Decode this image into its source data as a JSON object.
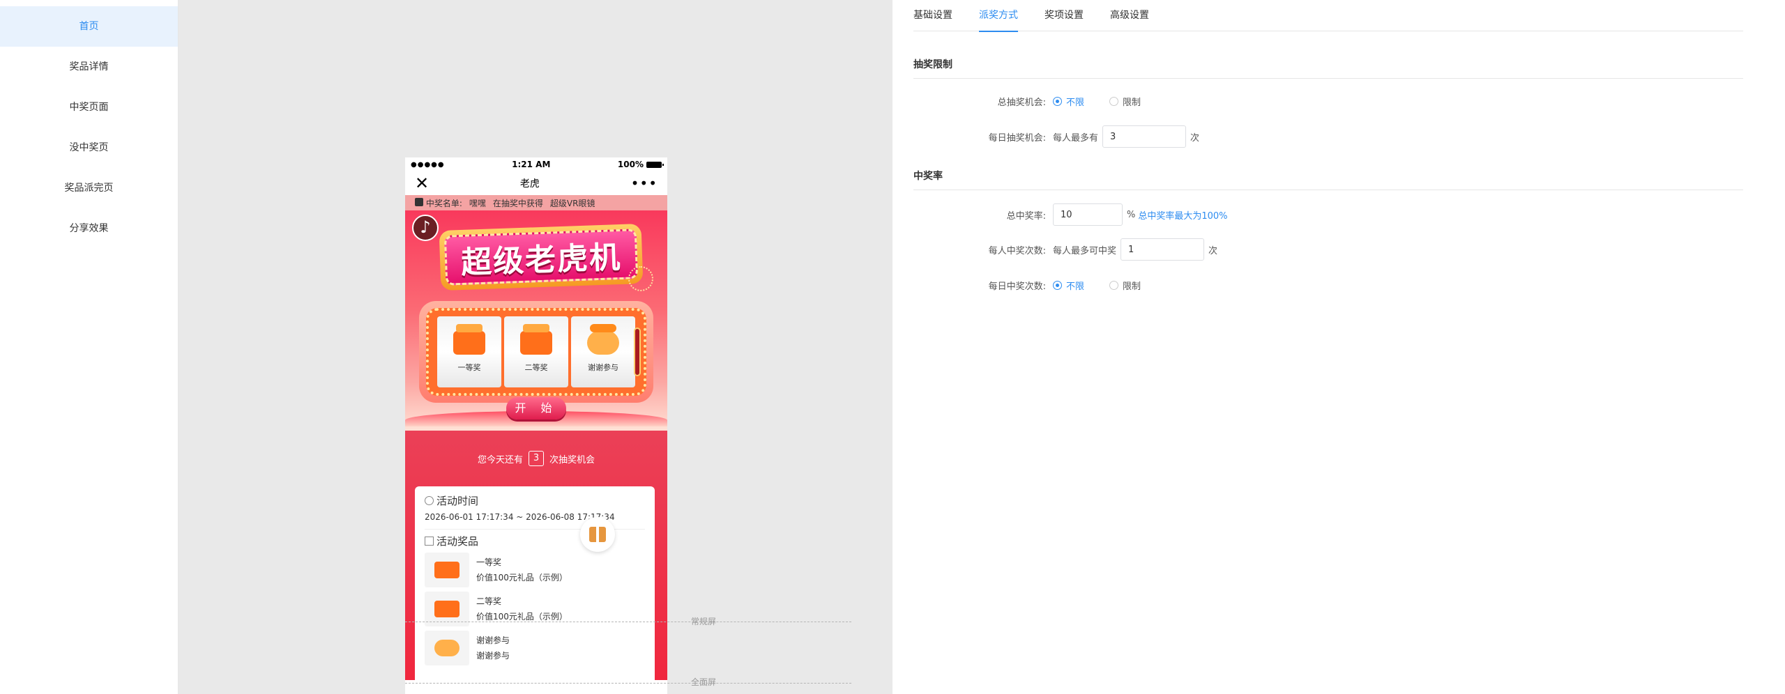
{
  "sidebar": {
    "items": [
      {
        "label": "首页",
        "active": true
      },
      {
        "label": "奖品详情"
      },
      {
        "label": "中奖页面"
      },
      {
        "label": "没中奖页"
      },
      {
        "label": "奖品派完页"
      },
      {
        "label": "分享效果"
      }
    ]
  },
  "phone": {
    "status": {
      "signal": "●●●●●",
      "time": "1:21 AM",
      "battery": "100%"
    },
    "title": "老虎",
    "ticker": {
      "prefix": "中奖名单:",
      "name": "嘿嘿",
      "action": "在抽奖中获得",
      "prize": "超级VR眼镜"
    },
    "banner_title": "超级老虎机",
    "reels": [
      "一等奖",
      "二等奖",
      "谢谢参与"
    ],
    "start_label": "开 始",
    "chance": {
      "before": "您今天还有",
      "count": "3",
      "after": "次抽奖机会"
    },
    "activity_time": {
      "title": "活动时间",
      "range": "2026-06-01 17:17:34 ~ 2026-06-08 17:17:34"
    },
    "activity_prizes": {
      "title": "活动奖品",
      "items": [
        {
          "name": "一等奖",
          "desc": "价值100元礼品（示例）"
        },
        {
          "name": "二等奖",
          "desc": "价值100元礼品（示例）"
        },
        {
          "name": "谢谢参与",
          "desc": "谢谢参与"
        }
      ]
    }
  },
  "guides": {
    "normal": "常规屏",
    "full": "全面屏"
  },
  "panel": {
    "tabs": [
      "基础设置",
      "派奖方式",
      "奖项设置",
      "高级设置"
    ],
    "active_tab": "派奖方式",
    "draw_limit": {
      "title": "抽奖限制",
      "total_label": "总抽奖机会:",
      "total_options": [
        "不限",
        "限制"
      ],
      "daily_label": "每日抽奖机会:",
      "daily_prefix": "每人最多有",
      "daily_value": "3",
      "daily_suffix": "次"
    },
    "win_rate": {
      "title": "中奖率",
      "total_label": "总中奖率:",
      "total_value": "10",
      "total_suffix": "%",
      "total_hint": "总中奖率最大为100%",
      "per_person_label": "每人中奖次数:",
      "per_person_prefix": "每人最多可中奖",
      "per_person_value": "1",
      "per_person_suffix": "次",
      "daily_label": "每日中奖次数:",
      "daily_options": [
        "不限",
        "限制"
      ]
    }
  },
  "colors": {
    "accent": "#2d8cf0",
    "sidebar_active_bg": "#e8f2fd",
    "canvas_bg": "#e9e9e9",
    "lottery_red": "#f0273e"
  }
}
